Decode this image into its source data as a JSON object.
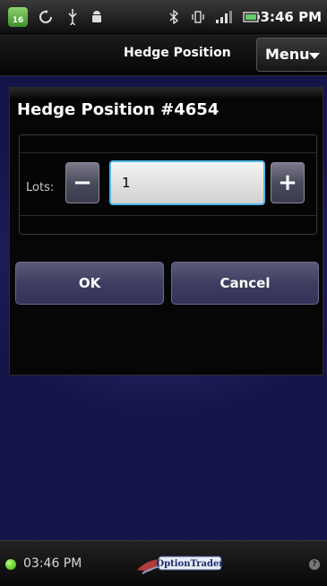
{
  "status_bar": {
    "calendar_day": "16",
    "clock": "3:46 PM",
    "icons": [
      "calendar-icon",
      "sync-icon",
      "usb-icon",
      "android-debug-icon",
      "bluetooth-icon",
      "vibrate-icon",
      "signal-icon",
      "battery-icon"
    ]
  },
  "title_bar": {
    "title": "Hedge Position",
    "menu_label": "Menu"
  },
  "dialog": {
    "title": "Hedge Position #4654",
    "lots_label": "Lots:",
    "minus_label": "−",
    "plus_label": "+",
    "lots_value": "1",
    "ok_label": "OK",
    "cancel_label": "Cancel"
  },
  "footer": {
    "time": "03:46 PM",
    "logo_text": "OptionTrader",
    "help_label": "?",
    "connection_status_color": "#2ea800"
  },
  "colors": {
    "background": "#2a2a78",
    "accent_input_border": "#4fb8e8"
  }
}
